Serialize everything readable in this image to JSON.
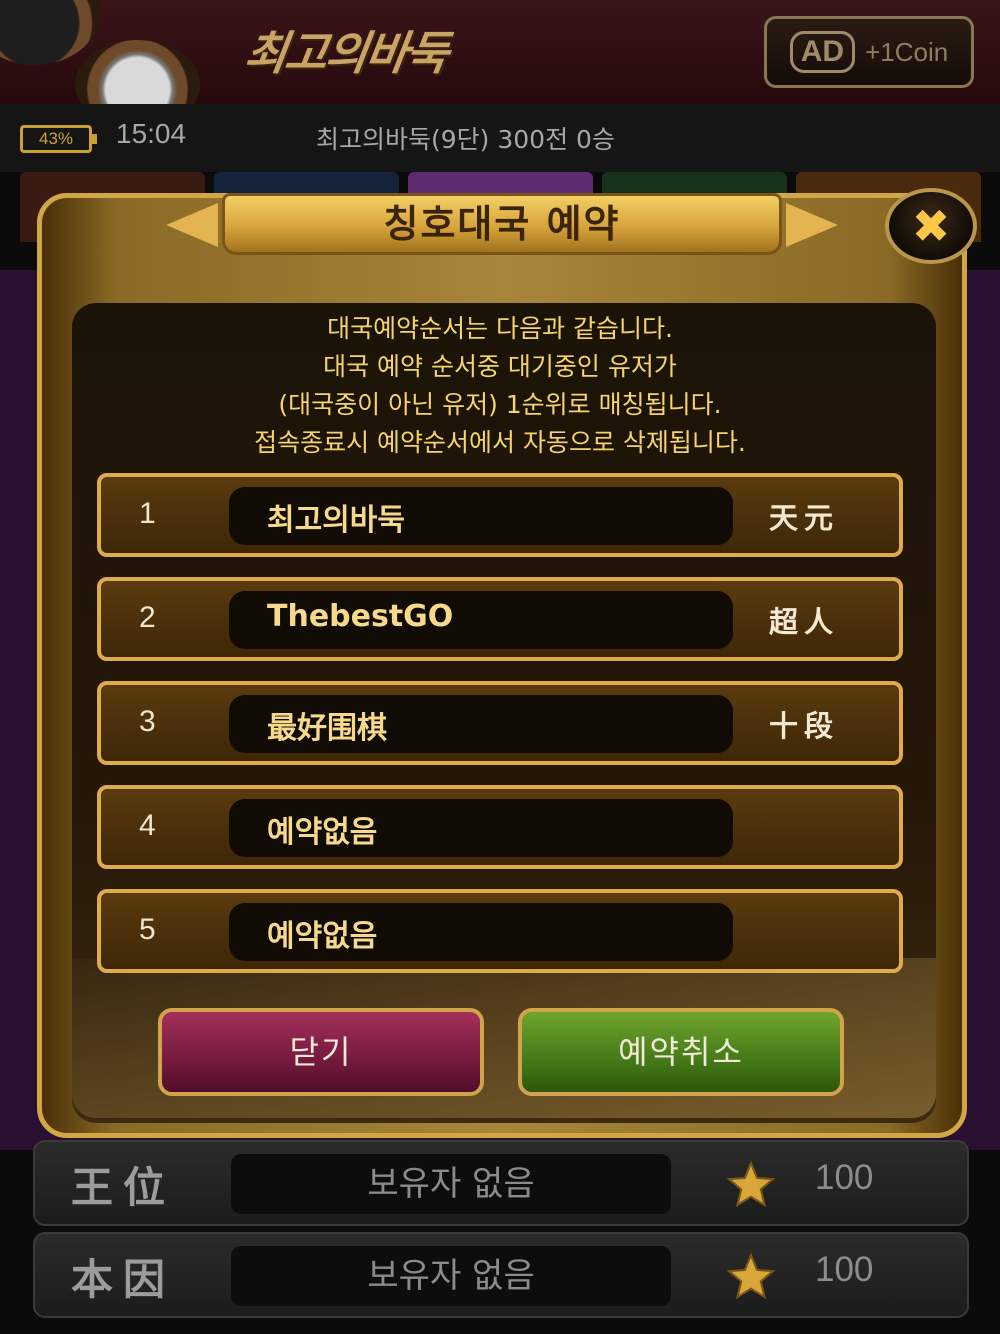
{
  "header": {
    "logo_text": "최고의바둑",
    "ad_badge": "AD",
    "ad_reward": "+1Coin"
  },
  "status": {
    "battery": "43%",
    "time": "15:04",
    "profile": "최고의바둑(9단) 300전 0승"
  },
  "colors": {
    "accent_gold": "#e0ab4b",
    "info_text": "#f3d46e",
    "close_button": "#6e1638",
    "cancel_button": "#3f7214",
    "tabs": [
      "#3a1b12",
      "#14233a",
      "#5e2b6e",
      "#16331a",
      "#4a2a0c"
    ]
  },
  "modal": {
    "title": "칭호대국 예약",
    "info_lines": [
      "대국예약순서는 다음과 같습니다.",
      "대국 예약 순서중 대기중인 유저가",
      "(대국중이 아닌 유저) 1순위로 매칭됩니다.",
      "접속종료시 예약순서에서 자동으로 삭제됩니다."
    ],
    "reservations": [
      {
        "rank": "1",
        "name": "최고의바둑",
        "title": "天元"
      },
      {
        "rank": "2",
        "name": "ThebestGO",
        "title": "超人"
      },
      {
        "rank": "3",
        "name": "最好围棋",
        "title": "十段"
      },
      {
        "rank": "4",
        "name": "예약없음",
        "title": ""
      },
      {
        "rank": "5",
        "name": "예약없음",
        "title": ""
      }
    ],
    "close_label": "닫기",
    "cancel_label": "예약취소"
  },
  "background_rows": [
    {
      "title": "王位",
      "holder": "보유자 없음",
      "coins": "100"
    },
    {
      "title": "本因",
      "holder": "보유자 없음",
      "coins": "100"
    }
  ]
}
